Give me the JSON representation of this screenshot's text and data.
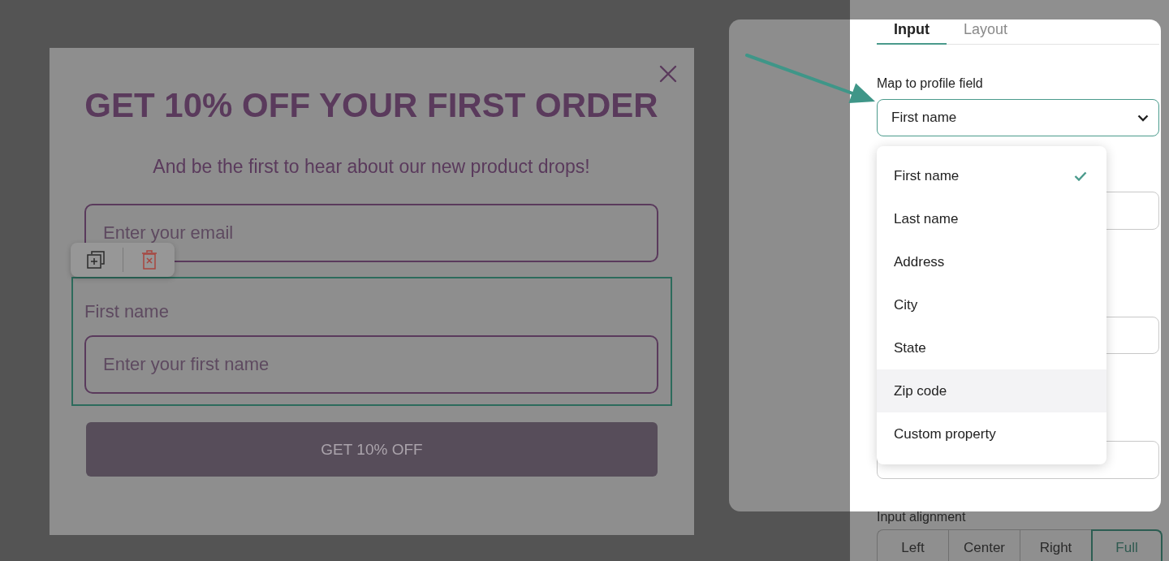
{
  "popup": {
    "title": "GET 10% OFF YOUR FIRST ORDER",
    "subtitle": "And be the first to hear about our new product drops!",
    "email_field": {
      "placeholder": "Enter your email"
    },
    "selected_field": {
      "label": "First name",
      "placeholder": "Enter your first name"
    },
    "submit_button": "GET 10% OFF"
  },
  "panel": {
    "tabs": [
      {
        "label": "Input",
        "selected": true
      },
      {
        "label": "Layout",
        "selected": false
      }
    ],
    "map_field": {
      "label": "Map to profile field",
      "value": "First name",
      "expanded": true,
      "options": [
        {
          "label": "First name",
          "selected": true,
          "highlighted": false
        },
        {
          "label": "Last name",
          "selected": false,
          "highlighted": false
        },
        {
          "label": "Address",
          "selected": false,
          "highlighted": false
        },
        {
          "label": "City",
          "selected": false,
          "highlighted": false
        },
        {
          "label": "State",
          "selected": false,
          "highlighted": false
        },
        {
          "label": "Zip code",
          "selected": false,
          "highlighted": true
        },
        {
          "label": "Custom property",
          "selected": false,
          "highlighted": false
        }
      ]
    },
    "input_alignment": {
      "label": "Input alignment",
      "options": [
        {
          "label": "Left",
          "selected": false
        },
        {
          "label": "Center",
          "selected": false
        },
        {
          "label": "Right",
          "selected": false
        },
        {
          "label": "Full",
          "selected": true
        }
      ]
    }
  }
}
